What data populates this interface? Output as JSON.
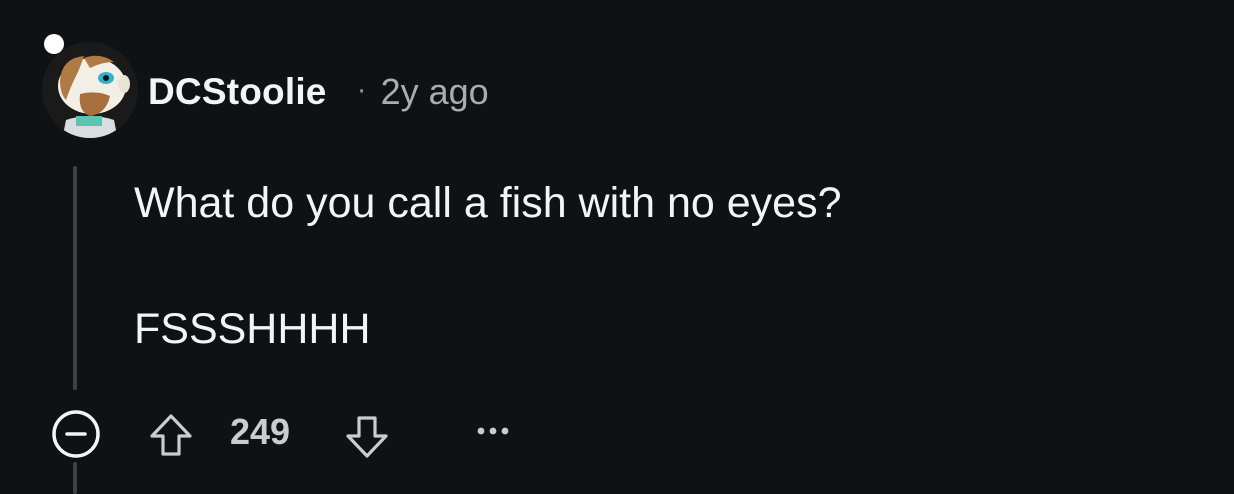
{
  "comment": {
    "author": "DCStoolie",
    "separator": "·",
    "timestamp": "2y ago",
    "body_lines": [
      "What do you call a fish with no eyes?",
      "FSSSHHHH"
    ],
    "vote_count": "249"
  },
  "icons": {
    "avatar": "snoo-avatar-icon",
    "collapse": "collapse-minus-icon",
    "upvote": "upvote-arrow-icon",
    "downvote": "downvote-arrow-icon",
    "more": "more-options-icon"
  },
  "colors": {
    "background": "#0e1214",
    "text": "#f2f4f5",
    "muted": "#a7adb1",
    "thread_line": "#3c4346"
  }
}
